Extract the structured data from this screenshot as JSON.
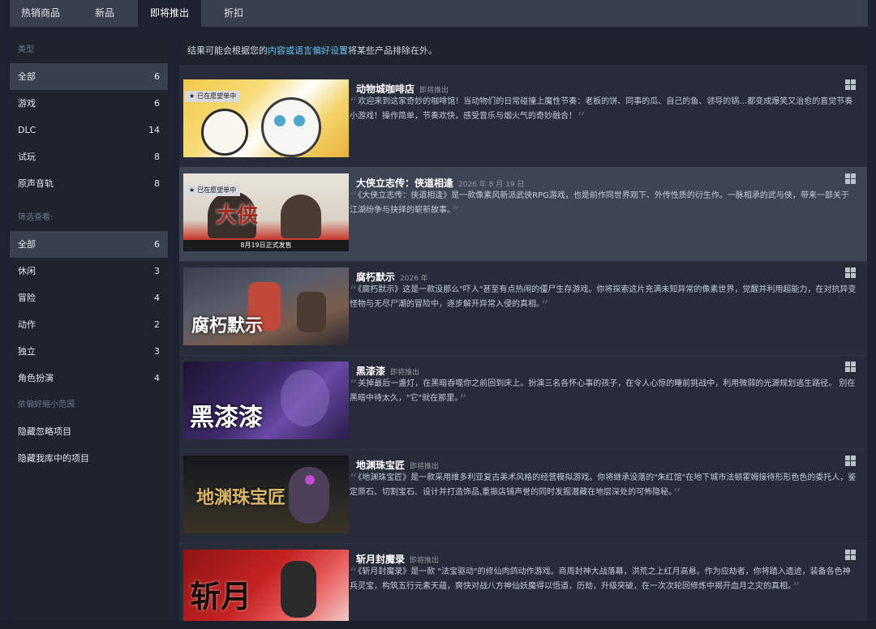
{
  "tabs": [
    {
      "label": "热销商品"
    },
    {
      "label": "新品"
    },
    {
      "label": "即将推出"
    },
    {
      "label": "折扣"
    }
  ],
  "sidebar": {
    "type_header": "类型",
    "type_items": [
      {
        "label": "全部",
        "count": "6"
      },
      {
        "label": "游戏",
        "count": "6"
      },
      {
        "label": "DLC",
        "count": "14"
      },
      {
        "label": "试玩",
        "count": "8"
      },
      {
        "label": "原声音轨",
        "count": "8"
      }
    ],
    "filter_header": "筛选查看:",
    "filter_items": [
      {
        "label": "全部",
        "count": "6"
      },
      {
        "label": "休闲",
        "count": "3"
      },
      {
        "label": "冒险",
        "count": "4"
      },
      {
        "label": "动作",
        "count": "2"
      },
      {
        "label": "独立",
        "count": "3"
      },
      {
        "label": "角色扮演",
        "count": "4"
      }
    ],
    "pref_header": "依偏好缩小范围",
    "pref_items": [
      {
        "label": "隐藏忽略项目"
      },
      {
        "label": "隐藏我库中的项目"
      }
    ]
  },
  "notice": {
    "prefix": "结果可能会根据您的",
    "link": "内容或语言偏好设置",
    "suffix": "将某些产品排除在外。"
  },
  "games": [
    {
      "name": "动物城咖啡店",
      "date": "即将推出",
      "wishlist": "已在愿望单中",
      "desc": "欢迎来到这家奇妙的咖啡馆！当动物们的日常碰撞上魔性节奏：老板的饼、同事的瓜、自己的鱼、领导的锅…都变成爆笑又治愈的直觉节奏小游戏！操作简单，节奏欢快，感受音乐与烟火气的奇妙融合！",
      "thumb_text": ""
    },
    {
      "name": "大侠立志传：侠道相逢",
      "date": "2026 年 8 月 19 日",
      "wishlist": "已在愿望单中",
      "desc": "《大侠立志传：侠道相逢》是一款像素风新派武侠RPG游戏，也是前作同世界观下、外传性质的衍生作。一脉相承的武与侠，带来一部关于江湖纷争与抉择的崭新故事。",
      "thumb_text": "8月19日正式发售"
    },
    {
      "name": "腐朽默示",
      "date": "2026 年",
      "wishlist": "",
      "desc": "《腐朽默示》这是一款没那么\"吓人\"甚至有点热闹的僵尸生存游戏。你将探索这片充满未知异常的像素世界，觉醒并利用超能力，在对抗异变怪物与无尽尸潮的冒险中，逐步解开异常入侵的真相。",
      "thumb_text": "腐朽默示"
    },
    {
      "name": "黑漆漆",
      "date": "即将推出",
      "wishlist": "",
      "desc": "关掉最后一盏灯，在黑暗吞噬你之前回到床上。扮演三名各怀心事的孩子，在令人心惊的睡前挑战中，利用微弱的光源规划逃生路径。 别在黑暗中待太久，\"它\"就在那里。",
      "thumb_text": "黑漆漆"
    },
    {
      "name": "地渊珠宝匠",
      "date": "即将推出",
      "wishlist": "",
      "desc": "《地渊珠宝匠》是一款采用维多利亚复古美术风格的经营模拟游戏。你将继承没落的\"朱红馆\"在地下城市法顿霍姆接待形形色色的委托人，鉴定原石、切割宝石、设计并打造饰品,重振店铺声誉的同时发掘潜藏在地层深处的可怖隐秘。",
      "thumb_text": "地渊珠宝匠"
    },
    {
      "name": "斩月封魔录",
      "date": "即将推出",
      "wishlist": "",
      "desc": "《斩月封魔录》是一款 \"法宝驱动\"的修仙肉鸽动作游戏。商周封神大战落幕，洪荒之上红月高悬。作为应劫者，你将踏入遗迹，装备各色神兵灵宝，构筑五行元素天蕴，爽快对战八方神仙妖魔得以悟道，历劫，升级突破，在一次次轮回修炼中揭开血月之灾的真相。",
      "thumb_text": "斩月"
    }
  ],
  "colors": {
    "background": "#1e2230",
    "tab_bar": "#3a3f4d",
    "sidebar_active": "#3b404d",
    "content_bg": "#282c38",
    "row_highlight": "#3e4453",
    "link": "#66c0f4"
  },
  "icons": {
    "platform": "windows-icon",
    "wishlist": "star-icon",
    "quote_open": "quote-open-icon",
    "quote_close": "quote-close-icon"
  }
}
